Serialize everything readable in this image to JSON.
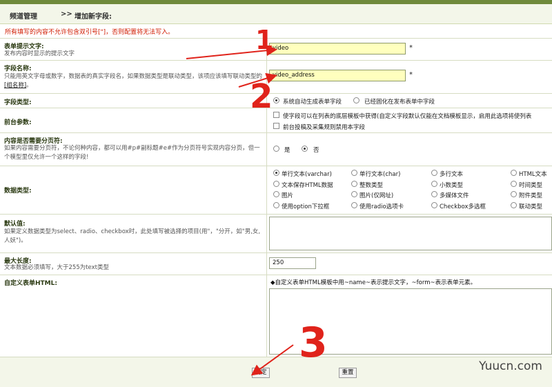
{
  "breadcrumb": {
    "section": "频道管理",
    "separator": ">>",
    "page": "增加新字段:"
  },
  "warning": "所有填写的内容不允许包含双引号[\"]，否则配置将无法写入。",
  "form_prompt": {
    "label": "表单提示文字:",
    "desc": "发布内容时显示的提示文字",
    "value": "video",
    "required": "*"
  },
  "field_name": {
    "label": "字段名称:",
    "desc": "只能用英文字母或数字，数据表的真实字段名，如果数据类型是联动类型，该项应该填写联动类型的",
    "desc_link": "[组名称]",
    "desc_end": "。",
    "value": "video_address",
    "required": "*"
  },
  "field_type": {
    "label": "字段类型:",
    "options": [
      "系统自动生成表单字段",
      "已经固化在发布表单中字段"
    ],
    "selected": 0
  },
  "frontend": {
    "label": "前台参数:",
    "options": [
      "使字段可以在列表的底层模板中获得(自定义字段默认仅能在文档模板显示，启用此选项将使列表",
      "前台投稿及采集规则禁用本字段"
    ]
  },
  "paging": {
    "label": "内容是否需要分页符:",
    "desc": "如果内容需要分页符，不论何种内容，都可以用#p#副标题#e#作为分页符号实现内容分页，但一个模型里仅允许一个这样的字段!",
    "options": [
      "是",
      "否"
    ],
    "selected": 1
  },
  "data_type": {
    "label": "数据类型:",
    "selected": 0,
    "options": [
      "单行文本(varchar)",
      "单行文本(char)",
      "多行文本",
      "HTML文本",
      "文本保存HTML数据",
      "整数类型",
      "小数类型",
      "时间类型",
      "图片",
      "图片(仅网址)",
      "多媒体文件",
      "附件类型",
      "使用option下拉框",
      "使用radio选项卡",
      "Checkbox多选框",
      "联动类型"
    ]
  },
  "default_value": {
    "label": "默认值:",
    "desc": "如果定义数据类型为select、radio、checkbox时，此处填写被选择的项目(用\"，\"分开，如\"男,女,人妖\")。",
    "value": ""
  },
  "max_length": {
    "label": "最大长度:",
    "desc": "文本数据必须填写，大于255为text类型",
    "value": "250"
  },
  "custom_html": {
    "label": "自定义表单HTML:",
    "note": "◆自定义表单HTML模板中用~name~表示提示文字，~form~表示表单元素。",
    "value": ""
  },
  "buttons": {
    "ok": "确定",
    "reset": "重置"
  },
  "annotations": [
    "1",
    "2",
    "3"
  ],
  "watermark": "Yuucn.com",
  "colors": {
    "annotation": "#e0231b",
    "header_bar": "#6f8a3c",
    "input_highlight": "#ffffbe",
    "warning": "#d01b00"
  }
}
